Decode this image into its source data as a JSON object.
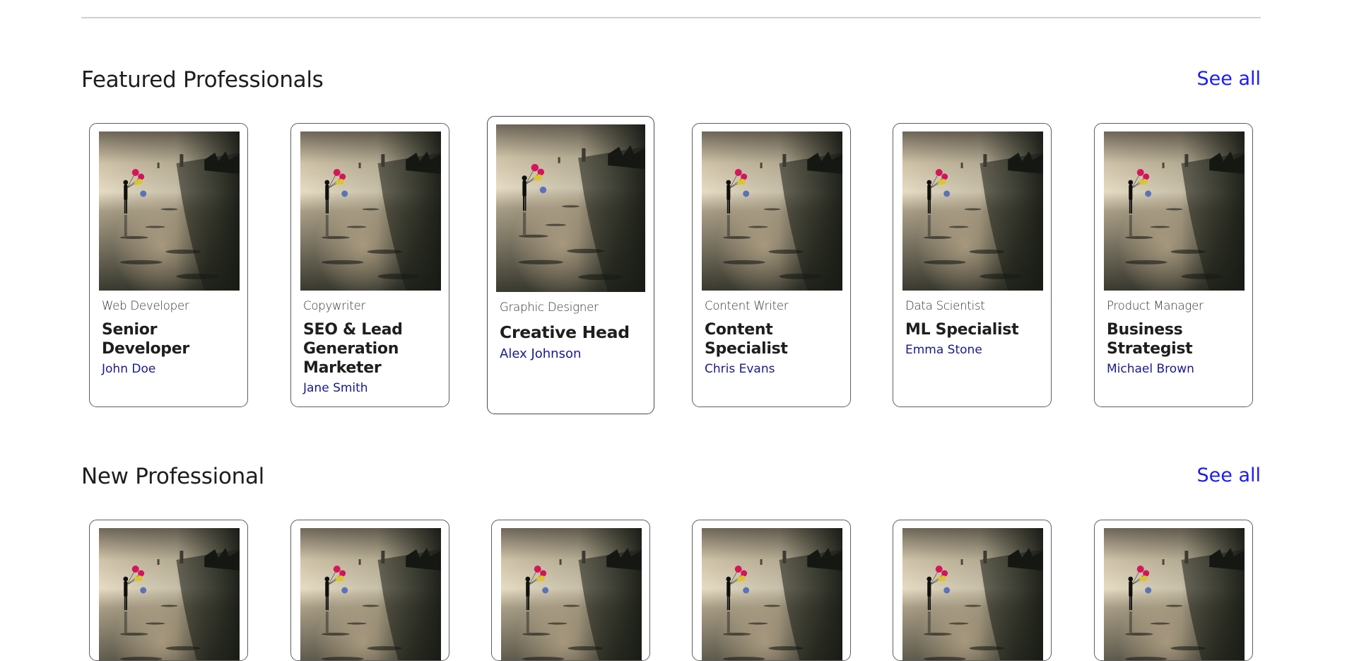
{
  "sections": {
    "featured": {
      "title": "Featured Professionals",
      "see_all": "See all",
      "cards": [
        {
          "role": "Web Developer",
          "title": "Senior Developer",
          "name": "John Doe"
        },
        {
          "role": "Copywriter",
          "title": "SEO & Lead Generation Marketer",
          "name": "Jane Smith"
        },
        {
          "role": "Graphic Designer",
          "title": "Creative Head",
          "name": "Alex Johnson"
        },
        {
          "role": "Content Writer",
          "title": "Content Specialist",
          "name": "Chris Evans"
        },
        {
          "role": "Data Scientist",
          "title": "ML Specialist",
          "name": "Emma Stone"
        },
        {
          "role": "Product Manager",
          "title": "Business Strategist",
          "name": "Michael Brown"
        }
      ]
    },
    "new": {
      "title": "New Professional",
      "see_all": "See all"
    }
  },
  "colors": {
    "link": "#1a1aff",
    "person_name": "#1a1a8c",
    "card_border": "#5f5f5f",
    "divider": "#cfcfcf"
  }
}
